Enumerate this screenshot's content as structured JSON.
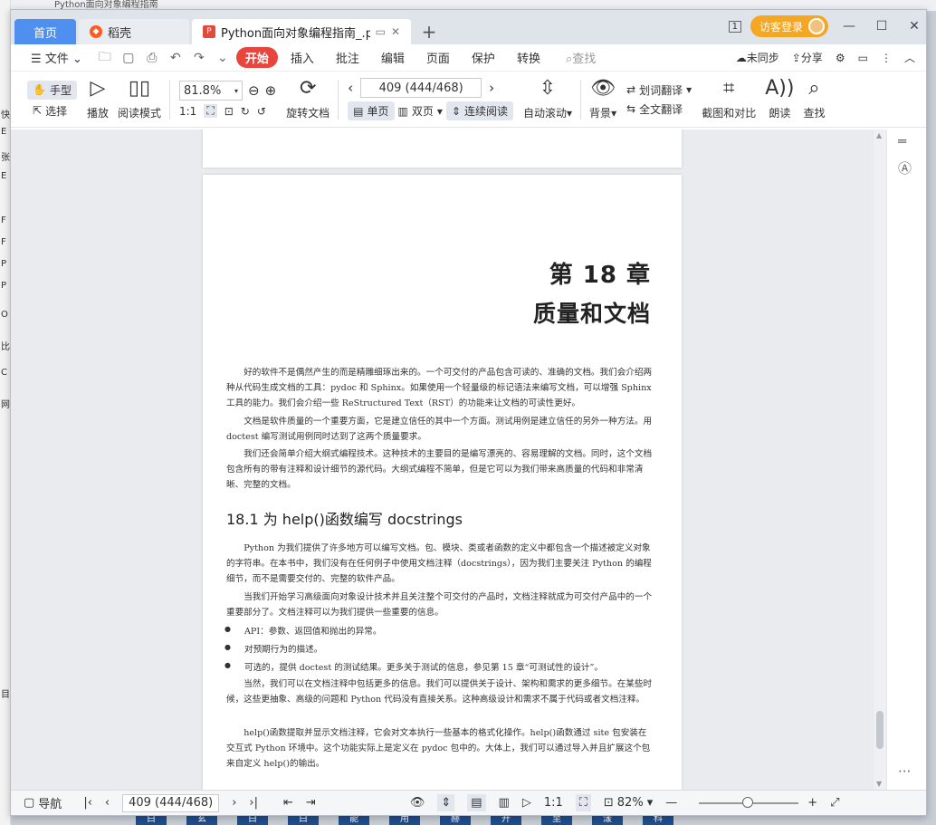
{
  "window": {
    "tabs": [
      {
        "label": "首页",
        "active": false
      },
      {
        "label": "稻壳",
        "active": false
      },
      {
        "label": "Python面向对象编程指南_.pdf",
        "active": true
      }
    ],
    "login_label": "访客登录",
    "page_badge": "1"
  },
  "menu": {
    "file": "文件",
    "items": [
      "开始",
      "插入",
      "批注",
      "编辑",
      "页面",
      "保护",
      "转换"
    ],
    "search": "查找",
    "sync": "未同步",
    "share": "分享"
  },
  "ribbon": {
    "hand": "手型",
    "select": "选择",
    "play": "播放",
    "read_mode": "阅读模式",
    "zoom": "81.8%",
    "rotate": "旋转文档",
    "page_value": "409 (444/468)",
    "single": "单页",
    "double": "双页",
    "continuous": "连续阅读",
    "auto_scroll": "自动滚动",
    "background": "背景",
    "word_translate": "划词翻译",
    "full_translate": "全文翻译",
    "screenshot": "截图和对比",
    "read_aloud": "朗读",
    "find": "查找"
  },
  "document": {
    "chapter_num": "第 18 章",
    "chapter_title": "质量和文档",
    "para1": "好的软件不是偶然产生的而是精雕细琢出来的。一个可交付的产品包含可读的、准确的文档。我们会介绍两种从代码生成文档的工具：pydoc 和 Sphinx。如果使用一个轻量级的标记语法来编写文档，可以增强 Sphinx 工具的能力。我们会介绍一些 ReStructured Text（RST）的功能来让文档的可读性更好。",
    "para2": "文档是软件质量的一个重要方面，它是建立信任的其中一个方面。测试用例是建立信任的另外一种方法。用 doctest 编写测试用例同时达到了这两个质量要求。",
    "para3": "我们还会简单介绍大纲式编程技术。这种技术的主要目的是编写漂亮的、容易理解的文档。同时，这个文档包含所有的带有注释和设计细节的源代码。大纲式编程不简单，但是它可以为我们带来高质量的代码和非常清晰、完整的文档。",
    "section": "18.1  为 help()函数编写 docstrings",
    "para4": "Python 为我们提供了许多地方可以编写文档。包、模块、类或者函数的定义中都包含一个描述被定义对象的字符串。在本书中，我们没有在任何例子中使用文档注释（docstrings），因为我们主要关注 Python 的编程细节，而不是需要交付的、完整的软件产品。",
    "para5": "当我们开始学习高级面向对象设计技术并且关注整个可交付的产品时，文档注释就成为可交付产品中的一个重要部分了。文档注释可以为我们提供一些重要的信息。",
    "bullets": [
      "API：参数、返回值和抛出的异常。",
      "对预期行为的描述。",
      "可选的，提供 doctest 的测试结果。更多关于测试的信息，参见第 15 章“可测试性的设计”。"
    ],
    "para6": "当然，我们可以在文档注释中包括更多的信息。我们可以提供关于设计、架构和需求的更多细节。在某些时候，这些更抽象、高级的问题和 Python 代码没有直接关系。这种高级设计和需求不属于代码或者文档注释。",
    "para7": "help()函数提取并显示文档注释，它会对文本执行一些基本的格式化操作。help()函数通过 site 包安装在交互式 Python 环境中。这个功能实际上是定义在 pydoc 包中的。大体上，我们可以通过导入并且扩展这个包来自定义 help()的输出。"
  },
  "status": {
    "nav": "导航",
    "page_value": "409 (444/468)",
    "zoom": "82%"
  },
  "background": {
    "title": "Python面向对象编程指南",
    "left_chars": [
      "快",
      "E",
      "张",
      "E",
      "F",
      "F",
      "P",
      "P",
      "O",
      "比",
      "C",
      "网",
      "目"
    ],
    "bottom_chars": [
      "白",
      "玄",
      "白",
      "白",
      "能",
      "用",
      "赫",
      "开",
      "至",
      "漾",
      "科"
    ]
  }
}
